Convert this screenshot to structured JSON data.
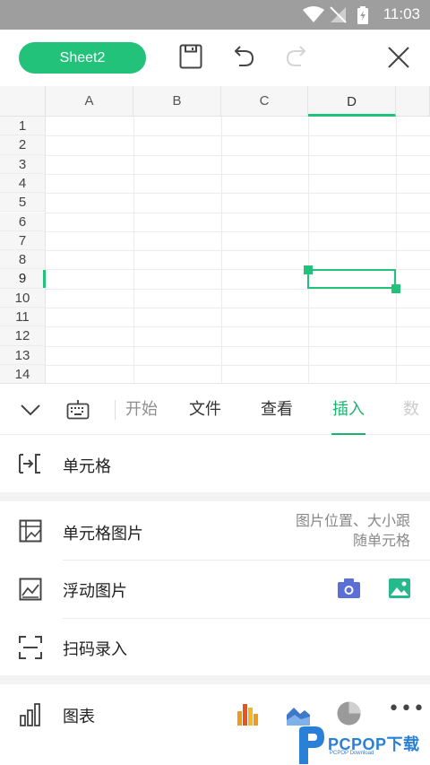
{
  "status_bar": {
    "time": "11:03"
  },
  "toolbar": {
    "sheet_label": "Sheet2"
  },
  "grid": {
    "columns": [
      "A",
      "B",
      "C",
      "D"
    ],
    "selected_column": "D",
    "rows": [
      "1",
      "2",
      "3",
      "4",
      "5",
      "6",
      "7",
      "8",
      "9",
      "10",
      "11",
      "12",
      "13",
      "14"
    ],
    "selected_row": "9"
  },
  "tabs": {
    "items": [
      "开始",
      "文件",
      "查看",
      "插入",
      "数"
    ],
    "active": "插入"
  },
  "panel": {
    "cell": {
      "label": "单元格"
    },
    "cell_image": {
      "label": "单元格图片",
      "hint_line1": "图片位置、大小跟",
      "hint_line2": "随单元格"
    },
    "float_image": {
      "label": "浮动图片"
    },
    "scan_input": {
      "label": "扫码录入"
    },
    "chart": {
      "label": "图表"
    }
  },
  "watermark": {
    "brand": "PCPOP下载",
    "sub": "PCPOP Download"
  },
  "colors": {
    "accent": "#22c27a",
    "status_bar": "#9e9e9e"
  }
}
